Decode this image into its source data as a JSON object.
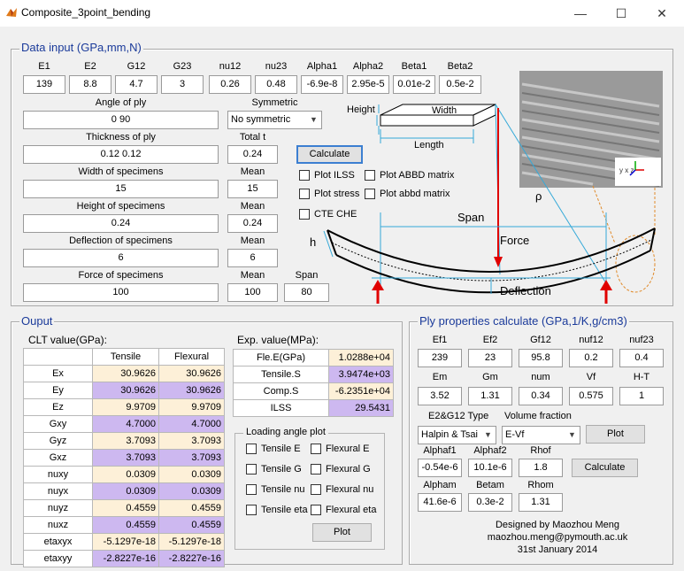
{
  "window": {
    "title": "Composite_3point_bending",
    "minimize": "—",
    "maximize": "☐",
    "close": "✕"
  },
  "data_input": {
    "title": "Data input (GPa,mm,N)",
    "props": [
      {
        "label": "E1",
        "value": "139"
      },
      {
        "label": "E2",
        "value": "8.8"
      },
      {
        "label": "G12",
        "value": "4.7"
      },
      {
        "label": "G23",
        "value": "3"
      },
      {
        "label": "nu12",
        "value": "0.26"
      },
      {
        "label": "nu23",
        "value": "0.48"
      },
      {
        "label": "Alpha1",
        "value": "-6.9e-8"
      },
      {
        "label": "Alpha2",
        "value": "2.95e-5"
      },
      {
        "label": "Beta1",
        "value": "0.01e-2"
      },
      {
        "label": "Beta2",
        "value": "0.5e-2"
      }
    ],
    "angle_label": "Angle of ply",
    "angle_value": "0 90",
    "symmetric_label": "Symmetric",
    "symmetric_value": "No symmetric",
    "thickness_label": "Thickness of ply",
    "thickness_value": "0.12 0.12",
    "total_label": "Total t",
    "total_value": "0.24",
    "width_label": "Width of specimens",
    "width_value": "15",
    "width_mean_label": "Mean",
    "width_mean": "15",
    "height_label": "Height of specimens",
    "height_value": "0.24",
    "height_mean_label": "Mean",
    "height_mean": "0.24",
    "deflection_label": "Deflection of specimens",
    "deflection_value": "6",
    "deflection_mean_label": "Mean",
    "deflection_mean": "6",
    "force_label": "Force of specimens",
    "force_value": "100",
    "force_mean_label": "Mean",
    "force_mean": "100",
    "span_label": "Span",
    "span_value": "80",
    "calculate": "Calculate",
    "checks": {
      "ilss": "Plot ILSS",
      "abbd": "Plot ABBD matrix",
      "stress": "Plot stress",
      "abbd_small": "Plot abbd matrix",
      "cte": "CTE CHE"
    }
  },
  "diagram": {
    "height": "Height",
    "width": "Width",
    "length": "Length",
    "rho": "ρ",
    "span": "Span",
    "force": "Force",
    "h": "h",
    "deflection": "Deflection",
    "axes": "y  x  z",
    "colors": {
      "red": "#e00000",
      "cyan": "#35a9d8"
    }
  },
  "output": {
    "title": "Ouput",
    "clt_label": "CLT value(GPa):",
    "columns": [
      "Tensile",
      "Flexural"
    ],
    "rows": [
      {
        "name": "Ex",
        "t": "30.9626",
        "f": "30.9626",
        "c": "y"
      },
      {
        "name": "Ey",
        "t": "30.9626",
        "f": "30.9626",
        "c": "p"
      },
      {
        "name": "Ez",
        "t": "9.9709",
        "f": "9.9709",
        "c": "y"
      },
      {
        "name": "Gxy",
        "t": "4.7000",
        "f": "4.7000",
        "c": "p"
      },
      {
        "name": "Gyz",
        "t": "3.7093",
        "f": "3.7093",
        "c": "y"
      },
      {
        "name": "Gxz",
        "t": "3.7093",
        "f": "3.7093",
        "c": "p"
      },
      {
        "name": "nuxy",
        "t": "0.0309",
        "f": "0.0309",
        "c": "y"
      },
      {
        "name": "nuyx",
        "t": "0.0309",
        "f": "0.0309",
        "c": "p"
      },
      {
        "name": "nuyz",
        "t": "0.4559",
        "f": "0.4559",
        "c": "y"
      },
      {
        "name": "nuxz",
        "t": "0.4559",
        "f": "0.4559",
        "c": "p"
      },
      {
        "name": "etaxyx",
        "t": "-5.1297e-18",
        "f": "-5.1297e-18",
        "c": "y"
      },
      {
        "name": "etaxyy",
        "t": "-2.8227e-16",
        "f": "-2.8227e-16",
        "c": "p"
      }
    ],
    "exp_label": "Exp. value(MPa):",
    "exp_rows": [
      {
        "name": "Fle.E(GPa)",
        "v": "1.0288e+04",
        "c": "y"
      },
      {
        "name": "Tensile.S",
        "v": "3.9474e+03",
        "c": "p"
      },
      {
        "name": "Comp.S",
        "v": "-6.2351e+04",
        "c": "y"
      },
      {
        "name": "ILSS",
        "v": "29.5431",
        "c": "p"
      }
    ],
    "loading_title": "Loading angle plot",
    "loading_checks": {
      "te": "Tensile E",
      "fe": "Flexural E",
      "tg": "Tensile G",
      "fg": "Flexural G",
      "tnu": "Tensile nu",
      "fnu": "Flexural nu",
      "teta": "Tensile eta",
      "feta": "Flexural eta"
    },
    "plot": "Plot"
  },
  "ply": {
    "title": "Ply properties calculate (GPa,1/K,g/cm3)",
    "row1": [
      {
        "label": "Ef1",
        "value": "239"
      },
      {
        "label": "Ef2",
        "value": "23"
      },
      {
        "label": "Gf12",
        "value": "95.8"
      },
      {
        "label": "nuf12",
        "value": "0.2"
      },
      {
        "label": "nuf23",
        "value": "0.4"
      }
    ],
    "row2": [
      {
        "label": "Em",
        "value": "3.52"
      },
      {
        "label": "Gm",
        "value": "1.31"
      },
      {
        "label": "num",
        "value": "0.34"
      },
      {
        "label": "Vf",
        "value": "0.575"
      },
      {
        "label": "H-T",
        "value": "1"
      }
    ],
    "e2g12_label": "E2&G12 Type",
    "e2g12_value": "Halpin & Tsai",
    "vf_label": "Volume fraction",
    "vf_value": "E-Vf",
    "plot": "Plot",
    "row3": [
      {
        "label": "Alphaf1",
        "value": "-0.54e-6"
      },
      {
        "label": "Alphaf2",
        "value": "10.1e-6"
      },
      {
        "label": "Rhof",
        "value": "1.8"
      }
    ],
    "row4": [
      {
        "label": "Alpham",
        "value": "41.6e-6"
      },
      {
        "label": "Betam",
        "value": "0.3e-2"
      },
      {
        "label": "Rhom",
        "value": "1.31"
      }
    ],
    "calculate": "Calculate",
    "credit1": "Designed by Maozhou Meng",
    "credit2": "maozhou.meng@pymouth.ac.uk",
    "credit3": "31st January 2014"
  }
}
